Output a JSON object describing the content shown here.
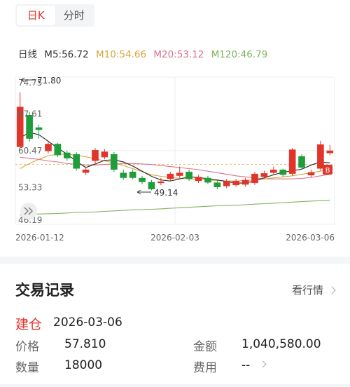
{
  "tabs": [
    {
      "label": "日K",
      "active": true
    },
    {
      "label": "分时",
      "active": false
    }
  ],
  "ma": {
    "label": "日线",
    "items": [
      {
        "text": "M5:56.72",
        "color": "#333333"
      },
      {
        "text": "M10:54.66",
        "color": "#d9a53a"
      },
      {
        "text": "M20:53.12",
        "color": "#d9738a"
      },
      {
        "text": "M120:46.79",
        "color": "#7fb35c"
      }
    ]
  },
  "chart_data": {
    "type": "candlestick",
    "y_ticks": [
      "74.75",
      "67.61",
      "60.47",
      "53.33",
      "46.19"
    ],
    "x_ticks": [
      "2026-01-12",
      "2026-02-03",
      "2026-03-06"
    ],
    "high_note": "71.80",
    "low_note": "49.14",
    "buy_marker": "B",
    "ylim": [
      46.19,
      74.75
    ],
    "colors": {
      "up": "#e0352b",
      "down": "#1f9d3a",
      "ma5": "#333333",
      "ma10": "#d9a53a",
      "ma20": "#d9738a",
      "ma120": "#7fb35c"
    },
    "candles": [
      {
        "o": 61.2,
        "c": 69.0,
        "h": 71.8,
        "l": 61.0
      },
      {
        "o": 67.4,
        "c": 62.8,
        "h": 68.0,
        "l": 62.2
      },
      {
        "o": 65.0,
        "c": 64.5,
        "h": 65.5,
        "l": 62.8
      },
      {
        "o": 60.4,
        "c": 61.8,
        "h": 62.2,
        "l": 60.0
      },
      {
        "o": 61.8,
        "c": 59.6,
        "h": 62.0,
        "l": 59.2
      },
      {
        "o": 60.1,
        "c": 59.0,
        "h": 60.5,
        "l": 58.5
      },
      {
        "o": 59.8,
        "c": 57.0,
        "h": 60.2,
        "l": 56.6
      },
      {
        "o": 56.2,
        "c": 56.8,
        "h": 57.4,
        "l": 55.8
      },
      {
        "o": 58.5,
        "c": 60.6,
        "h": 61.0,
        "l": 58.0
      },
      {
        "o": 59.2,
        "c": 60.3,
        "h": 60.8,
        "l": 58.8
      },
      {
        "o": 59.8,
        "c": 56.8,
        "h": 60.2,
        "l": 56.4
      },
      {
        "o": 56.2,
        "c": 55.2,
        "h": 56.8,
        "l": 54.8
      },
      {
        "o": 56.4,
        "c": 55.2,
        "h": 56.8,
        "l": 54.9
      },
      {
        "o": 55.2,
        "c": 54.4,
        "h": 55.6,
        "l": 54.0
      },
      {
        "o": 54.4,
        "c": 53.0,
        "h": 54.8,
        "l": 52.8
      },
      {
        "o": 54.2,
        "c": 54.5,
        "h": 55.2,
        "l": 53.8
      },
      {
        "o": 55.0,
        "c": 56.0,
        "h": 56.4,
        "l": 54.6
      },
      {
        "o": 55.6,
        "c": 56.2,
        "h": 57.4,
        "l": 55.2
      },
      {
        "o": 56.4,
        "c": 55.0,
        "h": 56.8,
        "l": 54.6
      },
      {
        "o": 54.6,
        "c": 55.4,
        "h": 55.8,
        "l": 54.2
      },
      {
        "o": 55.2,
        "c": 54.3,
        "h": 55.6,
        "l": 54.0
      },
      {
        "o": 54.3,
        "c": 53.4,
        "h": 54.8,
        "l": 53.0
      },
      {
        "o": 53.6,
        "c": 54.6,
        "h": 55.0,
        "l": 53.2
      },
      {
        "o": 53.8,
        "c": 54.6,
        "h": 55.0,
        "l": 53.4
      },
      {
        "o": 53.9,
        "c": 54.8,
        "h": 55.2,
        "l": 53.5
      },
      {
        "o": 54.2,
        "c": 56.0,
        "h": 56.4,
        "l": 53.8
      },
      {
        "o": 55.4,
        "c": 56.1,
        "h": 56.6,
        "l": 55.0
      },
      {
        "o": 56.2,
        "c": 56.8,
        "h": 57.4,
        "l": 55.8
      },
      {
        "o": 56.8,
        "c": 55.8,
        "h": 57.0,
        "l": 55.4
      },
      {
        "o": 56.0,
        "c": 60.7,
        "h": 61.0,
        "l": 55.6
      },
      {
        "o": 59.4,
        "c": 57.2,
        "h": 59.8,
        "l": 56.8
      },
      {
        "o": 55.7,
        "c": 56.3,
        "h": 56.8,
        "l": 55.3
      },
      {
        "o": 57.0,
        "c": 61.7,
        "h": 62.4,
        "l": 56.6
      },
      {
        "o": 60.0,
        "c": 60.5,
        "h": 61.6,
        "l": 59.6
      }
    ],
    "ma5": [
      63.0,
      64.0,
      63.6,
      62.3,
      61.0,
      59.8,
      58.4,
      57.2,
      57.9,
      58.6,
      58.7,
      58.3,
      57.5,
      56.5,
      55.5,
      54.8,
      54.6,
      55.0,
      55.4,
      55.3,
      55.0,
      54.8,
      54.5,
      54.2,
      54.2,
      54.6,
      55.2,
      55.8,
      56.3,
      56.6,
      56.9,
      57.7,
      58.3,
      58.1
    ],
    "ma10": [
      57.0,
      58.0,
      58.8,
      59.5,
      59.8,
      59.8,
      59.6,
      59.3,
      58.9,
      58.5,
      58.1,
      57.6,
      57.0,
      56.4,
      55.8,
      55.5,
      55.3,
      55.1,
      55.0,
      54.9,
      54.8,
      54.7,
      54.6,
      54.6,
      54.7,
      54.8,
      55.0,
      55.2,
      55.4,
      55.6,
      55.9,
      56.2,
      56.5,
      56.8
    ],
    "ma20": [
      59.2,
      59.0,
      58.8,
      58.5,
      58.3,
      58.0,
      57.8,
      57.7,
      57.7,
      57.8,
      57.9,
      58.0,
      58.0,
      57.9,
      57.8,
      57.6,
      57.4,
      57.2,
      57.0,
      56.8,
      56.5,
      56.2,
      55.9,
      55.6,
      55.4,
      55.2,
      55.0,
      55.0,
      55.0,
      55.0,
      55.1,
      55.3,
      55.6,
      55.9
    ],
    "ma120": [
      48.0,
      48.1,
      48.2,
      48.25,
      48.3,
      48.4,
      48.5,
      48.55,
      48.6,
      48.7,
      48.8,
      48.9,
      49.0,
      49.05,
      49.1,
      49.2,
      49.3,
      49.4,
      49.5,
      49.6,
      49.7,
      49.8,
      49.85,
      49.9,
      50.0,
      50.1,
      50.2,
      50.3,
      50.4,
      50.5,
      50.6,
      50.7,
      50.8,
      50.9
    ],
    "ref_price": 57.81
  },
  "trades": {
    "title": "交易记录",
    "quote_link": "看行情",
    "record": {
      "action": "建仓",
      "date": "2026-03-06",
      "price_label": "价格",
      "price": "57.810",
      "amount_label": "金额",
      "amount": "1,040,580.00",
      "qty_label": "数量",
      "qty": "18000",
      "fee_label": "费用",
      "fee": "--"
    }
  }
}
